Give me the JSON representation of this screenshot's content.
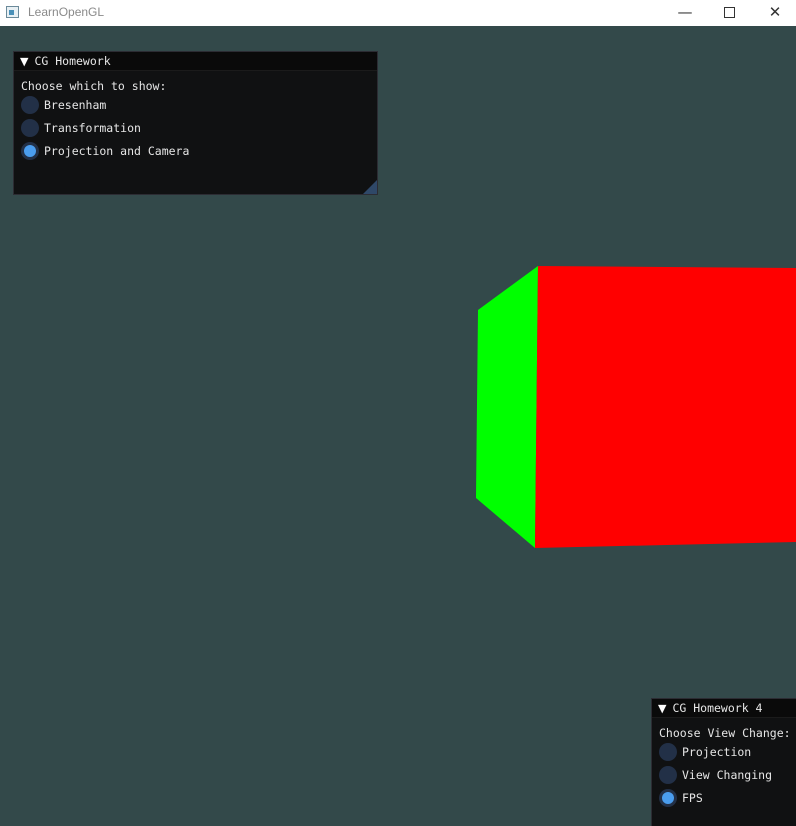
{
  "window": {
    "title": "LearnOpenGL",
    "minimize_glyph": "—",
    "close_glyph": "✕"
  },
  "colors": {
    "background": "#33494a",
    "cube_front": "#ff0000",
    "cube_side": "#00ff00",
    "radio_selected": "#4a9dee",
    "radio_unselected": "#223047"
  },
  "panel_main": {
    "title": "CG Homework",
    "collapse_icon": "▼",
    "prompt": "Choose which to show:",
    "options": [
      {
        "label": "Bresenham",
        "selected": false
      },
      {
        "label": "Transformation",
        "selected": false
      },
      {
        "label": "Projection and Camera",
        "selected": true
      }
    ]
  },
  "panel_view": {
    "title": "CG Homework 4",
    "collapse_icon": "▼",
    "prompt": "Choose View Change:",
    "options": [
      {
        "label": "Projection",
        "selected": false
      },
      {
        "label": "View Changing",
        "selected": false
      },
      {
        "label": "FPS",
        "selected": true
      }
    ]
  }
}
